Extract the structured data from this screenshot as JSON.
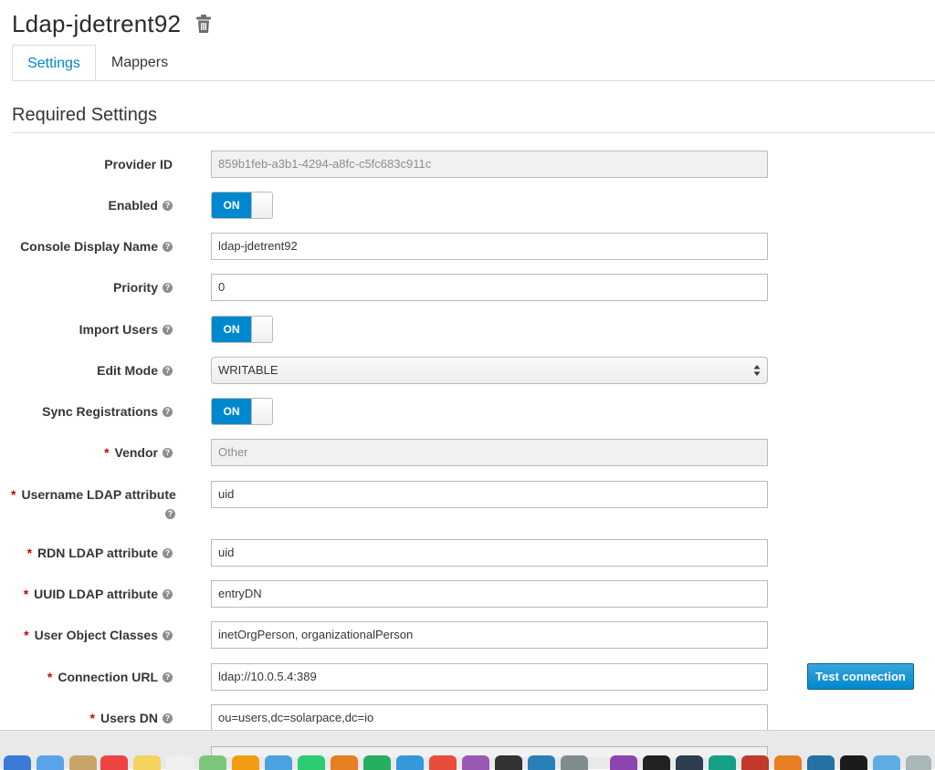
{
  "header": {
    "title": "Ldap-jdetrent92"
  },
  "tabs": [
    {
      "label": "Settings"
    },
    {
      "label": "Mappers"
    }
  ],
  "section": {
    "title": "Required Settings"
  },
  "fields": {
    "provider_id": {
      "label": "Provider ID",
      "value": "859b1feb-a3b1-4294-a8fc-c5fc683c911c"
    },
    "enabled": {
      "label": "Enabled",
      "state": "ON"
    },
    "console_display_name": {
      "label": "Console Display Name",
      "value": "ldap-jdetrent92"
    },
    "priority": {
      "label": "Priority",
      "value": "0"
    },
    "import_users": {
      "label": "Import Users",
      "state": "ON"
    },
    "edit_mode": {
      "label": "Edit Mode",
      "value": "WRITABLE"
    },
    "sync_registrations": {
      "label": "Sync Registrations",
      "state": "ON"
    },
    "vendor": {
      "label": "Vendor",
      "value": "Other"
    },
    "username_ldap_attribute": {
      "label": "Username LDAP attribute",
      "value": "uid"
    },
    "rdn_ldap_attribute": {
      "label": "RDN LDAP attribute",
      "value": "uid"
    },
    "uuid_ldap_attribute": {
      "label": "UUID LDAP attribute",
      "value": "entryDN"
    },
    "user_object_classes": {
      "label": "User Object Classes",
      "value": "inetOrgPerson, organizationalPerson"
    },
    "connection_url": {
      "label": "Connection URL",
      "value": "ldap://10.0.5.4:389"
    },
    "users_dn": {
      "label": "Users DN",
      "value": "ou=users,dc=solarpace,dc=io"
    }
  },
  "actions": {
    "test_connection": "Test connection"
  },
  "required_marker": "*",
  "help_glyph": "?",
  "colors": {
    "accent": "#0088ce",
    "required": "#cc0000",
    "help": "#8b8d8f"
  }
}
